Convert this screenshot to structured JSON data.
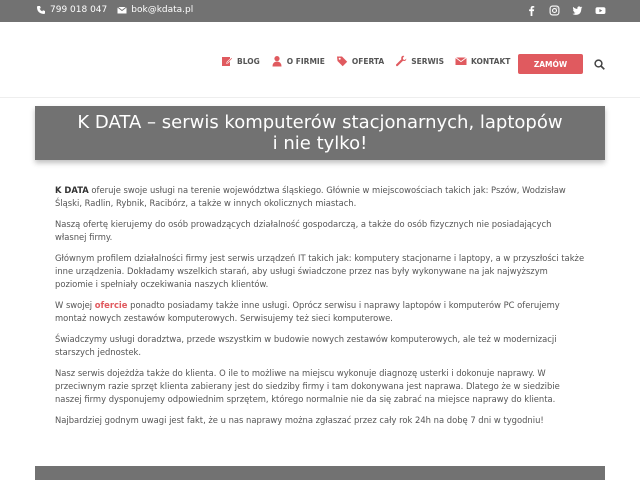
{
  "topbar": {
    "phone": "799 018 047",
    "email": "bok@kdata.pl",
    "social_icons": [
      "facebook-icon",
      "instagram-icon",
      "twitter-icon",
      "youtube-icon"
    ]
  },
  "nav": {
    "items": [
      {
        "label": "BLOG",
        "icon": "edit-icon"
      },
      {
        "label": "O FIRMIE",
        "icon": "user-icon"
      },
      {
        "label": "OFERTA",
        "icon": "tag-icon"
      },
      {
        "label": "SERWIS",
        "icon": "wrench-icon"
      },
      {
        "label": "KONTAKT",
        "icon": "envelope-icon"
      }
    ],
    "order_label": "ZAMÓW"
  },
  "page": {
    "title": "K DATA – serwis komputerów stacjonarnych, laptopów i nie tylko!"
  },
  "content": {
    "p1_bold": "K DATA",
    "p1_rest": " oferuje swoje usługi na terenie województwa śląskiego. Głównie w miejscowościach takich jak: Pszów, Wodzisław Śląski, Radlin, Rybnik, Racibórz, a także w innych okolicznych miastach.",
    "p2": "Naszą ofertę kierujemy do osób prowadzących działalność gospodarczą, a także do osób fizycznych nie posiadających własnej firmy.",
    "p3": "Głównym profilem działalności firmy jest serwis urządzeń IT takich jak: komputery stacjonarne i laptopy, a w przyszłości także inne urządzenia. Dokładamy wszelkich starań, aby usługi świadczone przez nas były wykonywane na jak najwyższym poziomie i spełniały oczekiwania naszych klientów.",
    "p4_start": "W swojej ",
    "p4_link": "ofercie",
    "p4_rest": " ponadto posiadamy także inne usługi. Oprócz serwisu i naprawy laptopów i komputerów PC oferujemy montaż nowych zestawów komputerowych. Serwisujemy też sieci komputerowe.",
    "p5": "Świadczymy usługi doradztwa, przede wszystkim w budowie nowych zestawów komputerowych, ale też w modernizacji starszych jednostek.",
    "p6": "Nasz serwis dojeżdża także do klienta. O ile to możliwe na miejscu wykonuje diagnozę usterki i dokonuje naprawy. W przeciwnym razie sprzęt klienta zabierany jest do siedziby firmy i tam dokonywana jest naprawa. Dlatego że w siedzibie naszej firmy dysponujemy odpowiednim sprzętem, którego normalnie nie da się zabrać na miejsce naprawy do klienta.",
    "p7": "Najbardziej godnym uwagi jest fakt, że u nas naprawy można zgłaszać przez cały rok 24h na dobę 7 dni w tygodniu!"
  },
  "colors": {
    "accent": "#e05a5f",
    "bar": "#727272",
    "text": "#555555"
  }
}
